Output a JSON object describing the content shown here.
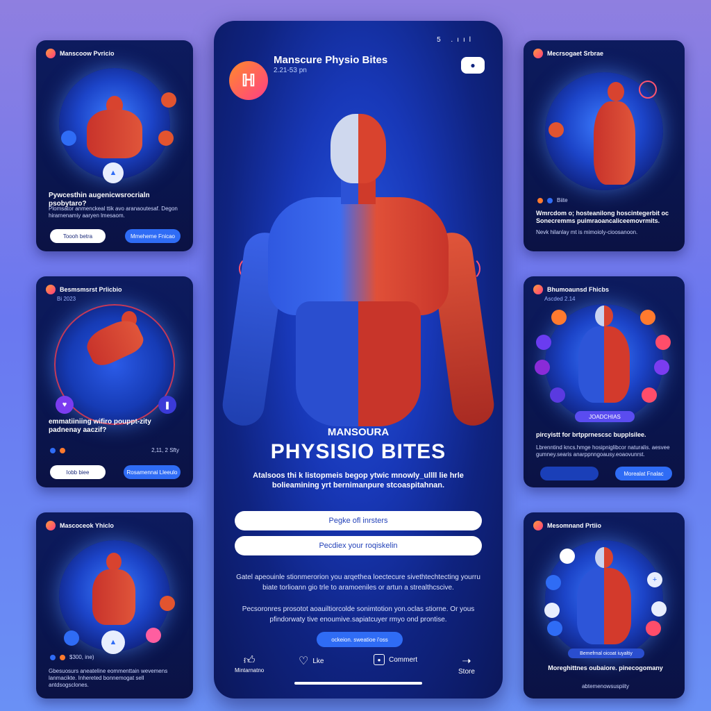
{
  "colors": {
    "accent": "#2f6cf5",
    "brand_gradient": [
      "#ff8a2b",
      "#ff3f86"
    ],
    "card_bg": "#0d1b5e"
  },
  "phone": {
    "status": "5 .ııl",
    "logo_mark": "ℍ",
    "account_name": "Manscure Physio Bites",
    "post_time": "2.21-53 pn",
    "more_icon": "ellipsis-icon",
    "kicker": "MANSOURA",
    "headline": "PHYSISIO BITES",
    "caption": "Atalsoos thi k listopmeis begop ytwic mnowly_ullll lie hrle bolieamining yrt bernimanpure stcoaspitahnan.",
    "cta_1": "Pegke ofl inrsters",
    "cta_2": "Pecdiex your roqiskelin",
    "body_1": "Gatel apeouinle stionmerorion you arqethea loectecure sivethtechtecting yourru biate torlioann gio trle to aramoeniles or artun a strealthcscive.",
    "body_2": "Pecsoronres prosotot aoauiltiorcolde sonimtotion yon.oclas stiorne. Or yous pfindorwaty tive enoumive.sapiatcuyer rmyo ond prontise.",
    "small_pill": "ockeion. sweatioe i'oss",
    "actions": [
      {
        "label": "Mintarnatno",
        "icon": "thumbs-up-icon"
      },
      {
        "label": "Lke",
        "icon": "heart-icon"
      },
      {
        "label": "Commert",
        "icon": "comment-icon"
      },
      {
        "label": "Store",
        "icon": "share-icon"
      }
    ]
  },
  "cards": [
    {
      "handle": "Manscoow Pvricio",
      "sub": "",
      "title": "Pywcesthin augenicwsrocrialn psobytaro?",
      "desc": "Plomsator anmenckeal ttik avo aranaoutesaf. Degon hirarnenamiy aaryen lmesaom.",
      "btn_1": "Toooh betra",
      "btn_2": "Mmeheme Fnicao",
      "meta": ""
    },
    {
      "handle": "Mecrsogaet Srbrae",
      "sub": "Biite",
      "title": "Wmrcdom o; hosteanilong hoscintegerbit oc Sonecremms puimraoancaliceemovrmits.",
      "desc": "Nevk hilanlay mt is mimoioly-cioosanoon.",
      "btn_1": "",
      "btn_2": "",
      "meta": "Biite"
    },
    {
      "handle": "Besmsmsrst Prlicbio",
      "sub": "Bi 2023",
      "title": "emmatiiniing wifiro pouppt-zity padnenay aaczif?",
      "desc": "",
      "btn_1": "Iobb biee",
      "btn_2": "Rosamennai Lleeulo",
      "meta": "2,11, 2 Sfty"
    },
    {
      "handle": "Bhumoaunsd Fhicbs",
      "sub": "Ascded  2.14",
      "title": "pircyistt for brtpprnescsc bupplsilee.",
      "desc": "Lbrenntind kncs.hmge hosipniglibcor naturalis. aesvee gumney.searis anarppnngoausy.eoaovunrst.",
      "btn_1": "",
      "btn_2": "Morealat Fnalac",
      "meta": "",
      "badge": "JOADCHIAS"
    },
    {
      "handle": "Mascoceok Yhiclo",
      "sub": "",
      "title": "",
      "desc": "Gbesuosurs aneateline eommenttain wevemens lanmacikte. Inhereted bonnemogat sell antdsogsclones.",
      "btn_1": "",
      "btn_2": "",
      "meta": "$300, ine)"
    },
    {
      "handle": "Mesomnand Prtiio",
      "sub": "",
      "title": "Moreghittnes oubaiore. pinecogomany",
      "desc": "abtemenowsuspiity",
      "btn_1": "",
      "btn_2": "",
      "meta": "",
      "badge": "Bemefrnal oicoat iuyaltiy"
    }
  ]
}
